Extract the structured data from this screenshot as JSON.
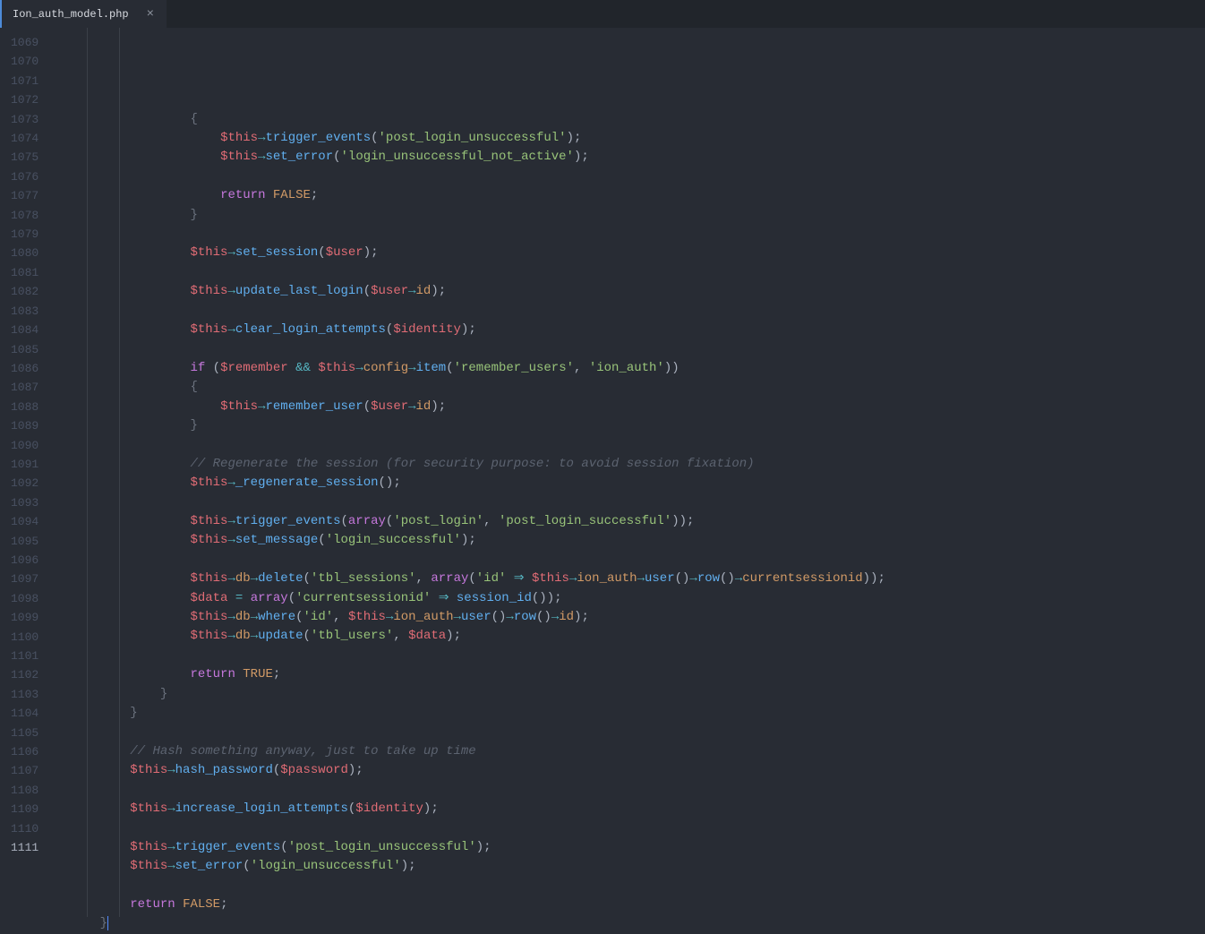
{
  "tab": {
    "filename": "Ion_auth_model.php",
    "close": "×"
  },
  "gutter": {
    "start": 1069,
    "end": 1111,
    "active": 1111
  },
  "code": {
    "l1069": "{",
    "l1070_a": "$this",
    "l1070_b": "trigger_events",
    "l1070_c": "'post_login_unsuccessful'",
    "l1071_a": "$this",
    "l1071_b": "set_error",
    "l1071_c": "'login_unsuccessful_not_active'",
    "l1073_a": "return",
    "l1073_b": "FALSE",
    "l1074": "}",
    "l1076_a": "$this",
    "l1076_b": "set_session",
    "l1076_c": "$user",
    "l1078_a": "$this",
    "l1078_b": "update_last_login",
    "l1078_c": "$user",
    "l1078_d": "id",
    "l1080_a": "$this",
    "l1080_b": "clear_login_attempts",
    "l1080_c": "$identity",
    "l1082_a": "if",
    "l1082_b": "$remember",
    "l1082_c": "&&",
    "l1082_d": "$this",
    "l1082_e": "config",
    "l1082_f": "item",
    "l1082_g": "'remember_users'",
    "l1082_h": "'ion_auth'",
    "l1083": "{",
    "l1084_a": "$this",
    "l1084_b": "remember_user",
    "l1084_c": "$user",
    "l1084_d": "id",
    "l1085": "}",
    "l1087": "// Regenerate the session (for security purpose: to avoid session fixation)",
    "l1088_a": "$this",
    "l1088_b": "_regenerate_session",
    "l1090_a": "$this",
    "l1090_b": "trigger_events",
    "l1090_c": "array",
    "l1090_d": "'post_login'",
    "l1090_e": "'post_login_successful'",
    "l1091_a": "$this",
    "l1091_b": "set_message",
    "l1091_c": "'login_successful'",
    "l1093_a": "$this",
    "l1093_b": "db",
    "l1093_c": "delete",
    "l1093_d": "'tbl_sessions'",
    "l1093_e": "array",
    "l1093_f": "'id'",
    "l1093_g": "$this",
    "l1093_h": "ion_auth",
    "l1093_i": "user",
    "l1093_j": "row",
    "l1093_k": "currentsessionid",
    "l1094_a": "$data",
    "l1094_b": "array",
    "l1094_c": "'currentsessionid'",
    "l1094_d": "session_id",
    "l1095_a": "$this",
    "l1095_b": "db",
    "l1095_c": "where",
    "l1095_d": "'id'",
    "l1095_e": "$this",
    "l1095_f": "ion_auth",
    "l1095_g": "user",
    "l1095_h": "row",
    "l1095_i": "id",
    "l1096_a": "$this",
    "l1096_b": "db",
    "l1096_c": "update",
    "l1096_d": "'tbl_users'",
    "l1096_e": "$data",
    "l1098_a": "return",
    "l1098_b": "TRUE",
    "l1099": "}",
    "l1100": "}",
    "l1102": "// Hash something anyway, just to take up time",
    "l1103_a": "$this",
    "l1103_b": "hash_password",
    "l1103_c": "$password",
    "l1105_a": "$this",
    "l1105_b": "increase_login_attempts",
    "l1105_c": "$identity",
    "l1107_a": "$this",
    "l1107_b": "trigger_events",
    "l1107_c": "'post_login_unsuccessful'",
    "l1108_a": "$this",
    "l1108_b": "set_error",
    "l1108_c": "'login_unsuccessful'",
    "l1110_a": "return",
    "l1110_b": "FALSE",
    "l1111": "}"
  }
}
